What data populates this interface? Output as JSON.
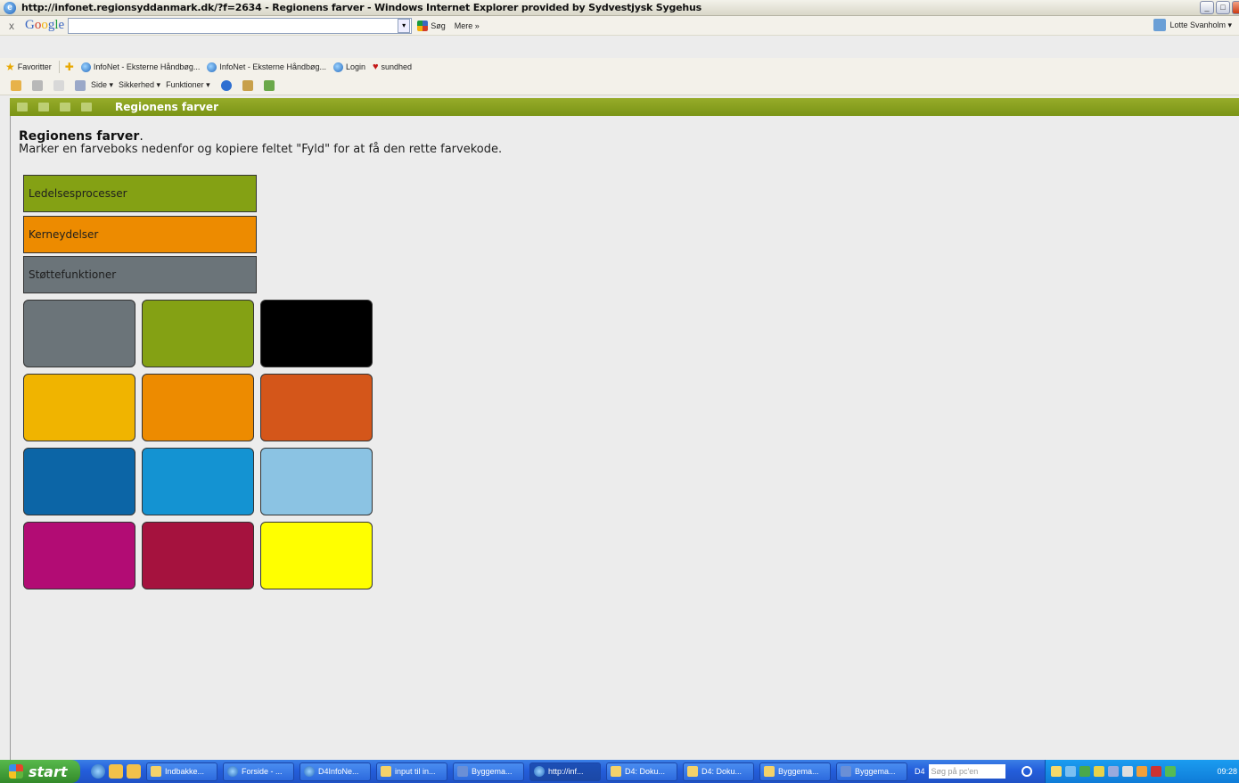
{
  "window": {
    "title": "http://infonet.regionsyddanmark.dk/?f=2634 - Regionens farver - Windows Internet Explorer provided by Sydvestjysk Sygehus",
    "controls": [
      "_",
      "□",
      "x"
    ]
  },
  "google_toolbar": {
    "close": "x",
    "logo": "Google",
    "search_value": "",
    "search_button": "Søg",
    "more": "Mere »",
    "user": "Lotte Svanholm ▾"
  },
  "favorites_bar": {
    "favorites_label": "Favoritter",
    "items": [
      {
        "label": "InfoNet - Eksterne Håndbøg..."
      },
      {
        "label": "InfoNet - Eksterne Håndbøg..."
      },
      {
        "label": "Login"
      },
      {
        "label": "sundhed"
      }
    ]
  },
  "command_bar": {
    "page": "Side ▾",
    "safety": "Sikkerhed ▾",
    "tools": "Funktioner ▾"
  },
  "page_header": {
    "title": "Regionens farver"
  },
  "content": {
    "heading": "Regionens farver",
    "heading_suffix": ".",
    "instruction": "Marker en farveboks nedenfor og kopiere feltet \"Fyld\" for at få den rette farvekode.",
    "bars": [
      {
        "label": "Ledelsesprocesser",
        "color": "#84a114"
      },
      {
        "label": "Kerneydelser",
        "color": "#ed8b00"
      },
      {
        "label": "Støttefunktioner",
        "color": "#6b7479"
      }
    ],
    "swatch_rows": [
      [
        "#6b7479",
        "#84a114",
        "#000000"
      ],
      [
        "#f0b400",
        "#ed8b00",
        "#d4561a"
      ],
      [
        "#0c65a6",
        "#1493d2",
        "#8bc3e3"
      ],
      [
        "#b20c74",
        "#a5123e",
        "#ffff00"
      ]
    ]
  },
  "taskbar": {
    "start": "start",
    "tasks": [
      {
        "label": "Indbakke...",
        "icon": "mail",
        "active": false
      },
      {
        "label": "Forside - ...",
        "icon": "ie",
        "active": false
      },
      {
        "label": "D4InfoNe...",
        "icon": "ie",
        "active": false
      },
      {
        "label": "input til in...",
        "icon": "mail",
        "active": false
      },
      {
        "label": "Byggema...",
        "icon": "word",
        "active": false
      },
      {
        "label": "http://inf...",
        "icon": "ie",
        "active": true
      },
      {
        "label": "D4: Doku...",
        "icon": "mail",
        "active": false
      },
      {
        "label": "D4: Doku...",
        "icon": "mail",
        "active": false
      },
      {
        "label": "Byggema...",
        "icon": "mail",
        "active": false
      },
      {
        "label": "Byggema...",
        "icon": "word",
        "active": false
      }
    ],
    "deskbar_label": "D4",
    "deskbar_placeholder": "Søg på pc'en",
    "clock": "09:28"
  }
}
